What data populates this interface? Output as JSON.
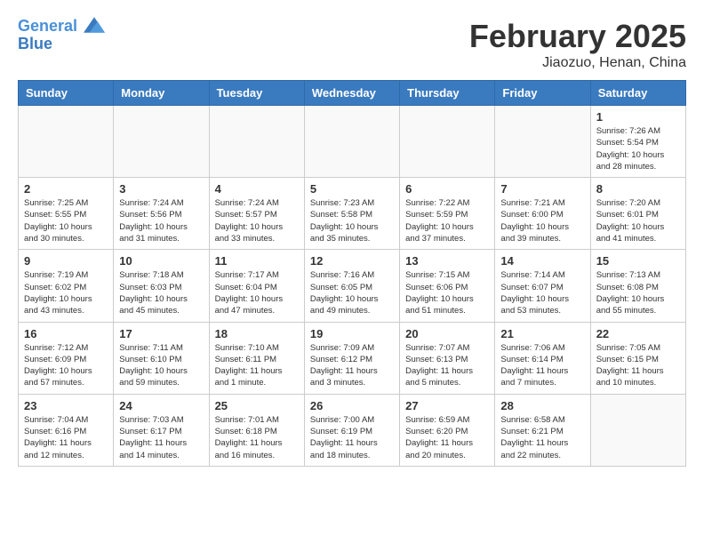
{
  "logo": {
    "line1": "General",
    "line2": "Blue"
  },
  "title": "February 2025",
  "location": "Jiaozuo, Henan, China",
  "days_of_week": [
    "Sunday",
    "Monday",
    "Tuesday",
    "Wednesday",
    "Thursday",
    "Friday",
    "Saturday"
  ],
  "weeks": [
    [
      {
        "day": "",
        "info": ""
      },
      {
        "day": "",
        "info": ""
      },
      {
        "day": "",
        "info": ""
      },
      {
        "day": "",
        "info": ""
      },
      {
        "day": "",
        "info": ""
      },
      {
        "day": "",
        "info": ""
      },
      {
        "day": "1",
        "info": "Sunrise: 7:26 AM\nSunset: 5:54 PM\nDaylight: 10 hours and 28 minutes."
      }
    ],
    [
      {
        "day": "2",
        "info": "Sunrise: 7:25 AM\nSunset: 5:55 PM\nDaylight: 10 hours and 30 minutes."
      },
      {
        "day": "3",
        "info": "Sunrise: 7:24 AM\nSunset: 5:56 PM\nDaylight: 10 hours and 31 minutes."
      },
      {
        "day": "4",
        "info": "Sunrise: 7:24 AM\nSunset: 5:57 PM\nDaylight: 10 hours and 33 minutes."
      },
      {
        "day": "5",
        "info": "Sunrise: 7:23 AM\nSunset: 5:58 PM\nDaylight: 10 hours and 35 minutes."
      },
      {
        "day": "6",
        "info": "Sunrise: 7:22 AM\nSunset: 5:59 PM\nDaylight: 10 hours and 37 minutes."
      },
      {
        "day": "7",
        "info": "Sunrise: 7:21 AM\nSunset: 6:00 PM\nDaylight: 10 hours and 39 minutes."
      },
      {
        "day": "8",
        "info": "Sunrise: 7:20 AM\nSunset: 6:01 PM\nDaylight: 10 hours and 41 minutes."
      }
    ],
    [
      {
        "day": "9",
        "info": "Sunrise: 7:19 AM\nSunset: 6:02 PM\nDaylight: 10 hours and 43 minutes."
      },
      {
        "day": "10",
        "info": "Sunrise: 7:18 AM\nSunset: 6:03 PM\nDaylight: 10 hours and 45 minutes."
      },
      {
        "day": "11",
        "info": "Sunrise: 7:17 AM\nSunset: 6:04 PM\nDaylight: 10 hours and 47 minutes."
      },
      {
        "day": "12",
        "info": "Sunrise: 7:16 AM\nSunset: 6:05 PM\nDaylight: 10 hours and 49 minutes."
      },
      {
        "day": "13",
        "info": "Sunrise: 7:15 AM\nSunset: 6:06 PM\nDaylight: 10 hours and 51 minutes."
      },
      {
        "day": "14",
        "info": "Sunrise: 7:14 AM\nSunset: 6:07 PM\nDaylight: 10 hours and 53 minutes."
      },
      {
        "day": "15",
        "info": "Sunrise: 7:13 AM\nSunset: 6:08 PM\nDaylight: 10 hours and 55 minutes."
      }
    ],
    [
      {
        "day": "16",
        "info": "Sunrise: 7:12 AM\nSunset: 6:09 PM\nDaylight: 10 hours and 57 minutes."
      },
      {
        "day": "17",
        "info": "Sunrise: 7:11 AM\nSunset: 6:10 PM\nDaylight: 10 hours and 59 minutes."
      },
      {
        "day": "18",
        "info": "Sunrise: 7:10 AM\nSunset: 6:11 PM\nDaylight: 11 hours and 1 minute."
      },
      {
        "day": "19",
        "info": "Sunrise: 7:09 AM\nSunset: 6:12 PM\nDaylight: 11 hours and 3 minutes."
      },
      {
        "day": "20",
        "info": "Sunrise: 7:07 AM\nSunset: 6:13 PM\nDaylight: 11 hours and 5 minutes."
      },
      {
        "day": "21",
        "info": "Sunrise: 7:06 AM\nSunset: 6:14 PM\nDaylight: 11 hours and 7 minutes."
      },
      {
        "day": "22",
        "info": "Sunrise: 7:05 AM\nSunset: 6:15 PM\nDaylight: 11 hours and 10 minutes."
      }
    ],
    [
      {
        "day": "23",
        "info": "Sunrise: 7:04 AM\nSunset: 6:16 PM\nDaylight: 11 hours and 12 minutes."
      },
      {
        "day": "24",
        "info": "Sunrise: 7:03 AM\nSunset: 6:17 PM\nDaylight: 11 hours and 14 minutes."
      },
      {
        "day": "25",
        "info": "Sunrise: 7:01 AM\nSunset: 6:18 PM\nDaylight: 11 hours and 16 minutes."
      },
      {
        "day": "26",
        "info": "Sunrise: 7:00 AM\nSunset: 6:19 PM\nDaylight: 11 hours and 18 minutes."
      },
      {
        "day": "27",
        "info": "Sunrise: 6:59 AM\nSunset: 6:20 PM\nDaylight: 11 hours and 20 minutes."
      },
      {
        "day": "28",
        "info": "Sunrise: 6:58 AM\nSunset: 6:21 PM\nDaylight: 11 hours and 22 minutes."
      },
      {
        "day": "",
        "info": ""
      }
    ]
  ]
}
